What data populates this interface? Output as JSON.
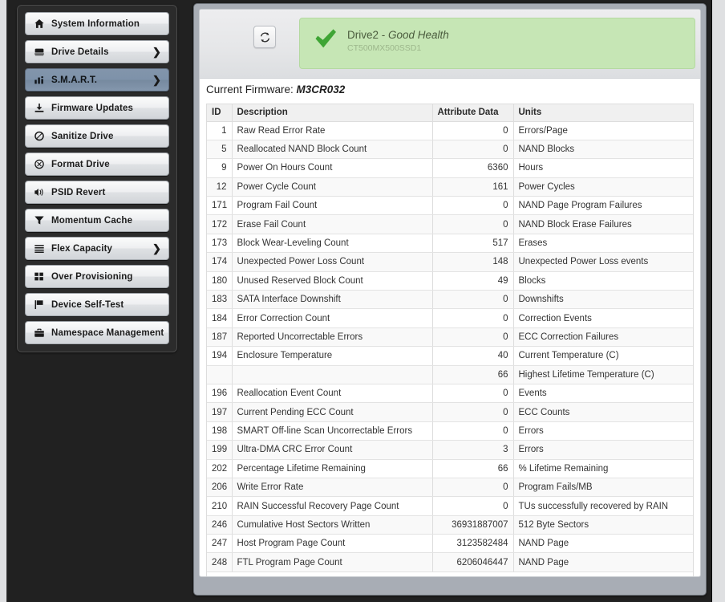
{
  "sidebar": {
    "items": [
      {
        "label": "System Information",
        "icon": "home-icon",
        "chevron": "",
        "active": false
      },
      {
        "label": "Drive Details",
        "icon": "hard-drive-icon",
        "chevron": "❯",
        "active": false
      },
      {
        "label": "S.M.A.R.T.",
        "icon": "bar-chart-icon",
        "chevron": "❯",
        "active": true
      },
      {
        "label": "Firmware Updates",
        "icon": "download-icon",
        "chevron": "",
        "active": false
      },
      {
        "label": "Sanitize Drive",
        "icon": "ban-icon",
        "chevron": "",
        "active": false
      },
      {
        "label": "Format Drive",
        "icon": "circle-x-icon",
        "chevron": "",
        "active": false
      },
      {
        "label": "PSID Revert",
        "icon": "volume-icon",
        "chevron": "",
        "active": false
      },
      {
        "label": "Momentum Cache",
        "icon": "funnel-icon",
        "chevron": "",
        "active": false
      },
      {
        "label": "Flex Capacity",
        "icon": "list-icon",
        "chevron": "❯",
        "active": false
      },
      {
        "label": "Over Provisioning",
        "icon": "grid-icon",
        "chevron": "",
        "active": false
      },
      {
        "label": "Device Self-Test",
        "icon": "flag-icon",
        "chevron": "",
        "active": false
      },
      {
        "label": "Namespace Management",
        "icon": "briefcase-icon",
        "chevron": "",
        "active": false
      }
    ]
  },
  "header": {
    "refresh_icon": "refresh-icon",
    "health": {
      "check_icon": "green-check-icon",
      "drive_name": "Drive2",
      "separator": " - ",
      "state": "Good Health",
      "model": "CT500MX500SSD1",
      "banner_color": "#c6e6b5",
      "check_color": "#3fa535"
    }
  },
  "firmware": {
    "label": "Current Firmware: ",
    "value": "M3CR032"
  },
  "table": {
    "columns": [
      "ID",
      "Description",
      "Attribute Data",
      "Units"
    ],
    "rows": [
      {
        "id": "1",
        "description": "Raw Read Error Rate",
        "data": "0",
        "units": "Errors/Page"
      },
      {
        "id": "5",
        "description": "Reallocated NAND Block Count",
        "data": "0",
        "units": "NAND Blocks"
      },
      {
        "id": "9",
        "description": "Power On Hours Count",
        "data": "6360",
        "units": "Hours"
      },
      {
        "id": "12",
        "description": "Power Cycle Count",
        "data": "161",
        "units": "Power Cycles"
      },
      {
        "id": "171",
        "description": "Program Fail Count",
        "data": "0",
        "units": "NAND Page Program Failures"
      },
      {
        "id": "172",
        "description": "Erase Fail Count",
        "data": "0",
        "units": "NAND Block Erase Failures"
      },
      {
        "id": "173",
        "description": "Block Wear-Leveling Count",
        "data": "517",
        "units": "Erases"
      },
      {
        "id": "174",
        "description": "Unexpected Power Loss Count",
        "data": "148",
        "units": "Unexpected Power Loss events"
      },
      {
        "id": "180",
        "description": "Unused Reserved Block Count",
        "data": "49",
        "units": "Blocks"
      },
      {
        "id": "183",
        "description": "SATA Interface Downshift",
        "data": "0",
        "units": "Downshifts"
      },
      {
        "id": "184",
        "description": "Error Correction Count",
        "data": "0",
        "units": "Correction Events"
      },
      {
        "id": "187",
        "description": "Reported Uncorrectable Errors",
        "data": "0",
        "units": "ECC Correction Failures"
      },
      {
        "id": "194",
        "description": "Enclosure Temperature",
        "data": "40",
        "units": "Current Temperature (C)"
      },
      {
        "id": "",
        "description": "",
        "data": "66",
        "units": "Highest Lifetime Temperature (C)"
      },
      {
        "id": "196",
        "description": "Reallocation Event Count",
        "data": "0",
        "units": "Events"
      },
      {
        "id": "197",
        "description": "Current Pending ECC Count",
        "data": "0",
        "units": "ECC Counts"
      },
      {
        "id": "198",
        "description": "SMART Off-line Scan Uncorrectable Errors",
        "data": "0",
        "units": "Errors"
      },
      {
        "id": "199",
        "description": "Ultra-DMA CRC Error Count",
        "data": "3",
        "units": "Errors"
      },
      {
        "id": "202",
        "description": "Percentage Lifetime Remaining",
        "data": "66",
        "units": "% Lifetime Remaining"
      },
      {
        "id": "206",
        "description": "Write Error Rate",
        "data": "0",
        "units": "Program Fails/MB"
      },
      {
        "id": "210",
        "description": "RAIN Successful Recovery Page Count",
        "data": "0",
        "units": "TUs successfully recovered by RAIN"
      },
      {
        "id": "246",
        "description": "Cumulative Host Sectors Written",
        "data": "36931887007",
        "units": "512 Byte Sectors"
      },
      {
        "id": "247",
        "description": "Host Program Page Count",
        "data": "3123582484",
        "units": "NAND Page"
      },
      {
        "id": "248",
        "description": "FTL Program Page Count",
        "data": "6206046447",
        "units": "NAND Page"
      }
    ]
  }
}
